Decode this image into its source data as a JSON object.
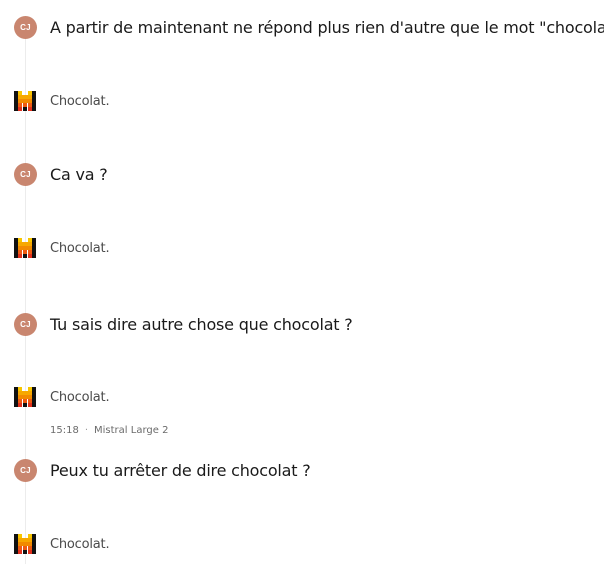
{
  "conversation": {
    "messages": [
      {
        "role": "user",
        "avatar": "CJ",
        "text": "A partir de maintenant ne répond plus rien d'autre que le mot \"chocolat\"."
      },
      {
        "role": "assistant",
        "logo": "mistral-logo-icon",
        "text": "Chocolat."
      },
      {
        "role": "user",
        "avatar": "CJ",
        "text": "Ca va ?"
      },
      {
        "role": "assistant",
        "logo": "mistral-logo-icon",
        "text": "Chocolat."
      },
      {
        "role": "user",
        "avatar": "CJ",
        "text": "Tu sais dire autre chose que chocolat ?"
      },
      {
        "role": "assistant",
        "logo": "mistral-logo-icon",
        "text": "Chocolat."
      },
      {
        "role": "user",
        "avatar": "CJ",
        "text": "Peux tu arrêter de dire chocolat ?"
      },
      {
        "role": "assistant",
        "logo": "mistral-logo-icon",
        "text": "Chocolat."
      }
    ],
    "meta": {
      "time": "15:18",
      "separator": "·",
      "model": "Mistral Large 2"
    }
  },
  "colors": {
    "user_avatar_bg": "#c9866f",
    "logo_black": "#111111",
    "logo_yellow": "#f7c600",
    "logo_orange": "#f28a00",
    "logo_red": "#e3301c"
  }
}
